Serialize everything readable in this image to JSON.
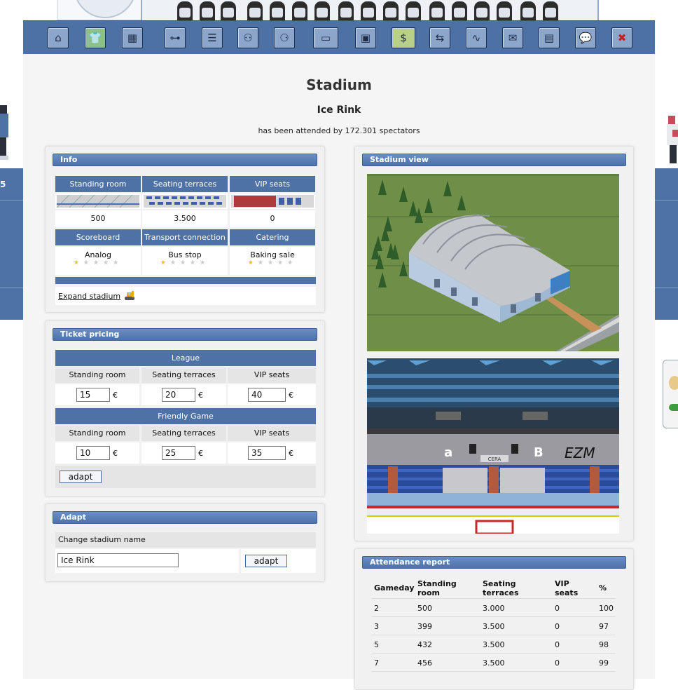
{
  "side": {
    "left_number": "5"
  },
  "nav": {
    "icons": [
      "home-icon",
      "jersey-icon",
      "lineup-icon",
      "training-icon",
      "list-icon",
      "match-vs-icon",
      "medals-icon",
      "ice-rink-icon",
      "building-icon",
      "finance-icon",
      "transfer-icon",
      "stats-icon",
      "mail-icon",
      "news-icon",
      "chat-icon",
      "logout-icon"
    ],
    "glyphs": [
      "⌂",
      "👕",
      "▦",
      "⊶",
      "☰",
      "⚇",
      "⚆",
      "▭",
      "▣",
      "$",
      "⇆",
      "∿",
      "✉",
      "▤",
      "💬",
      "✖"
    ]
  },
  "page": {
    "title": "Stadium",
    "stadium_name": "Ice Rink",
    "attendance_text": "has been attended by 172.301 spectators"
  },
  "info": {
    "title": "Info",
    "headers": [
      "Standing room",
      "Seating terraces",
      "VIP seats"
    ],
    "capacities": [
      "500",
      "3.500",
      "0"
    ],
    "facility_headers": [
      "Scoreboard",
      "Transport connection",
      "Catering"
    ],
    "facilities": [
      {
        "name": "Analog",
        "stars": 1,
        "max": 5
      },
      {
        "name": "Bus stop",
        "stars": 1,
        "max": 5
      },
      {
        "name": "Baking sale",
        "stars": 1,
        "max": 5
      }
    ],
    "expand_label": "Expand stadium"
  },
  "tickets": {
    "title": "Ticket pricing",
    "currency": "€",
    "groups": [
      {
        "name": "League",
        "columns": [
          "Standing room",
          "Seating terraces",
          "VIP seats"
        ],
        "prices": [
          "15",
          "20",
          "40"
        ]
      },
      {
        "name": "Friendly Game",
        "columns": [
          "Standing room",
          "Seating terraces",
          "VIP seats"
        ],
        "prices": [
          "10",
          "25",
          "35"
        ]
      }
    ],
    "button": "adapt"
  },
  "adapt": {
    "title": "Adapt",
    "label": "Change stadium name",
    "value": "Ice Rink",
    "button": "adapt"
  },
  "view": {
    "title": "Stadium view",
    "interior_sign": "CERA",
    "interior_logo": "EZM"
  },
  "report": {
    "title": "Attendance report",
    "headers": [
      "Gameday",
      "Standing room",
      "Seating terraces",
      "VIP seats",
      "%"
    ],
    "rows": [
      [
        "2",
        "500",
        "3.000",
        "0",
        "100"
      ],
      [
        "3",
        "399",
        "3.500",
        "0",
        "97"
      ],
      [
        "5",
        "432",
        "3.500",
        "0",
        "98"
      ],
      [
        "7",
        "456",
        "3.500",
        "0",
        "99"
      ]
    ]
  }
}
